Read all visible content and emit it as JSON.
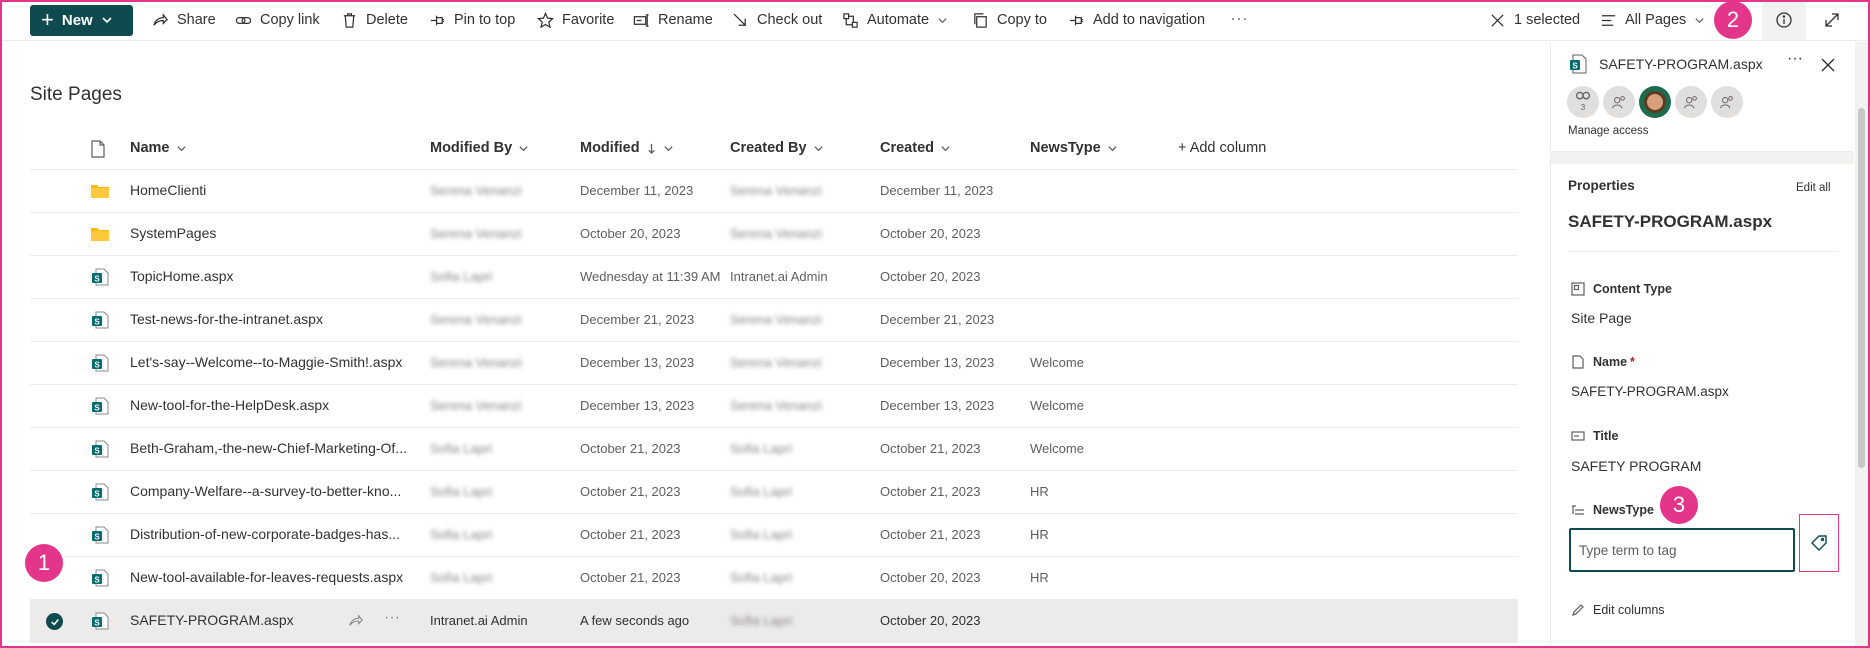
{
  "colors": {
    "accent": "#0f4a4e",
    "highlight": "#e3358a"
  },
  "toolbar": {
    "new_label": "New",
    "share": "Share",
    "copy_link": "Copy link",
    "delete": "Delete",
    "pin_to_top": "Pin to top",
    "favorite": "Favorite",
    "rename": "Rename",
    "check_out": "Check out",
    "automate": "Automate",
    "copy_to": "Copy to",
    "add_to_navigation": "Add to navigation",
    "more": "···",
    "selected_count": "1 selected",
    "view": "All Pages"
  },
  "badges": {
    "one": "1",
    "two": "2",
    "three": "3"
  },
  "list": {
    "title": "Site Pages",
    "columns": {
      "name": "Name",
      "modified_by": "Modified By",
      "modified": "Modified",
      "created_by": "Created By",
      "created": "Created",
      "news_type": "NewsType",
      "add_column": "+ Add column"
    },
    "rows": [
      {
        "type": "folder",
        "name": "HomeClienti",
        "modified_by": "Serena Venanzi",
        "modified": "December 11, 2023",
        "created_by": "Serena Venanzi",
        "created": "December 11, 2023",
        "news_type": ""
      },
      {
        "type": "folder",
        "name": "SystemPages",
        "modified_by": "Serena Venanzi",
        "modified": "October 20, 2023",
        "created_by": "Serena Venanzi",
        "created": "October 20, 2023",
        "news_type": ""
      },
      {
        "type": "page",
        "name": "TopicHome.aspx",
        "modified_by": "Sofia Lapri",
        "modified": "Wednesday at 11:39 AM",
        "created_by": "Intranet.ai Admin",
        "created": "October 20, 2023",
        "news_type": ""
      },
      {
        "type": "page",
        "name": "Test-news-for-the-intranet.aspx",
        "modified_by": "Serena Venanzi",
        "modified": "December 21, 2023",
        "created_by": "Serena Venanzi",
        "created": "December 21, 2023",
        "news_type": ""
      },
      {
        "type": "page",
        "name": "Let's-say--Welcome--to-Maggie-Smith!.aspx",
        "modified_by": "Serena Venanzi",
        "modified": "December 13, 2023",
        "created_by": "Serena Venanzi",
        "created": "December 13, 2023",
        "news_type": "Welcome"
      },
      {
        "type": "page",
        "name": "New-tool-for-the-HelpDesk.aspx",
        "modified_by": "Serena Venanzi",
        "modified": "December 13, 2023",
        "created_by": "Serena Venanzi",
        "created": "December 13, 2023",
        "news_type": "Welcome"
      },
      {
        "type": "page",
        "name": "Beth-Graham,-the-new-Chief-Marketing-Of...",
        "modified_by": "Sofia Lapri",
        "modified": "October 21, 2023",
        "created_by": "Sofia Lapri",
        "created": "October 21, 2023",
        "news_type": "Welcome"
      },
      {
        "type": "page",
        "name": "Company-Welfare--a-survey-to-better-kno...",
        "modified_by": "Sofia Lapri",
        "modified": "October 21, 2023",
        "created_by": "Sofia Lapri",
        "created": "October 21, 2023",
        "news_type": "HR"
      },
      {
        "type": "page",
        "name": "Distribution-of-new-corporate-badges-has...",
        "modified_by": "Sofia Lapri",
        "modified": "October 21, 2023",
        "created_by": "Sofia Lapri",
        "created": "October 21, 2023",
        "news_type": "HR"
      },
      {
        "type": "page",
        "name": "New-tool-available-for-leaves-requests.aspx",
        "modified_by": "Sofia Lapri",
        "modified": "October 21, 2023",
        "created_by": "Sofia Lapri",
        "created": "October 20, 2023",
        "news_type": "HR"
      },
      {
        "type": "page",
        "name": "SAFETY-PROGRAM.aspx",
        "modified_by": "Intranet.ai Admin",
        "modified": "A few seconds ago",
        "created_by": "Sofia Lapri",
        "created": "October 20, 2023",
        "news_type": "",
        "selected": true
      }
    ]
  },
  "details": {
    "file_name": "SAFETY-PROGRAM.aspx",
    "more": "···",
    "avatar_count": "3",
    "manage_access": "Manage access",
    "properties_heading": "Properties",
    "edit_all": "Edit all",
    "properties_title": "SAFETY-PROGRAM.aspx",
    "content_type_label": "Content Type",
    "content_type_value": "Site Page",
    "name_label": "Name",
    "name_required": "*",
    "name_value": "SAFETY-PROGRAM.aspx",
    "title_label": "Title",
    "title_value": "SAFETY PROGRAM",
    "newstype_label": "NewsType",
    "term_placeholder": "Type term to tag",
    "edit_columns": "Edit columns"
  }
}
